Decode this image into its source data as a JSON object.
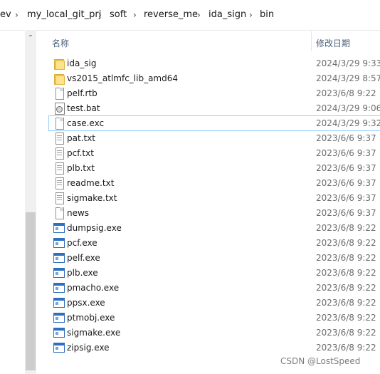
{
  "breadcrumb": {
    "items": [
      "ev",
      "my_local_git_prj",
      "soft",
      "reverse_me",
      "ida_sign",
      "bin"
    ],
    "separator": "›"
  },
  "scrollbar": {
    "up_glyph": "⌃"
  },
  "columns": {
    "name": "名称",
    "date_modified": "修改日期"
  },
  "files": [
    {
      "name": "ida_sig",
      "date": "2024/3/29 9:33",
      "type": "folder"
    },
    {
      "name": "vs2015_atlmfc_lib_amd64",
      "date": "2024/3/29 8:57",
      "type": "folder"
    },
    {
      "name": "pelf.rtb",
      "date": "2023/6/8 9:22",
      "type": "file"
    },
    {
      "name": "test.bat",
      "date": "2024/3/29 9:06",
      "type": "bat"
    },
    {
      "name": "case.exc",
      "date": "2024/3/29 9:32",
      "type": "file",
      "selected": true
    },
    {
      "name": "pat.txt",
      "date": "2023/6/6 9:37",
      "type": "txt"
    },
    {
      "name": "pcf.txt",
      "date": "2023/6/6 9:37",
      "type": "txt"
    },
    {
      "name": "plb.txt",
      "date": "2023/6/6 9:37",
      "type": "txt"
    },
    {
      "name": "readme.txt",
      "date": "2023/6/6 9:37",
      "type": "txt"
    },
    {
      "name": "sigmake.txt",
      "date": "2023/6/6 9:37",
      "type": "txt"
    },
    {
      "name": "news",
      "date": "2023/6/6 9:37",
      "type": "file"
    },
    {
      "name": "dumpsig.exe",
      "date": "2023/6/8 9:22",
      "type": "exe"
    },
    {
      "name": "pcf.exe",
      "date": "2023/6/8 9:22",
      "type": "exe"
    },
    {
      "name": "pelf.exe",
      "date": "2023/6/8 9:22",
      "type": "exe"
    },
    {
      "name": "plb.exe",
      "date": "2023/6/8 9:22",
      "type": "exe"
    },
    {
      "name": "pmacho.exe",
      "date": "2023/6/8 9:22",
      "type": "exe"
    },
    {
      "name": "ppsx.exe",
      "date": "2023/6/8 9:22",
      "type": "exe"
    },
    {
      "name": "ptmobj.exe",
      "date": "2023/6/8 9:22",
      "type": "exe"
    },
    {
      "name": "sigmake.exe",
      "date": "2023/6/8 9:22",
      "type": "exe"
    },
    {
      "name": "zipsig.exe",
      "date": "2023/6/8 9:22",
      "type": "exe"
    }
  ],
  "watermark": "CSDN @LostSpeed",
  "colors": {
    "header_text": "#4c607a",
    "date_text": "#6d6d6d",
    "selection_border": "#99d1ff",
    "folder_yellow": "#f4cf63",
    "exe_blue": "#2f6fbf"
  }
}
